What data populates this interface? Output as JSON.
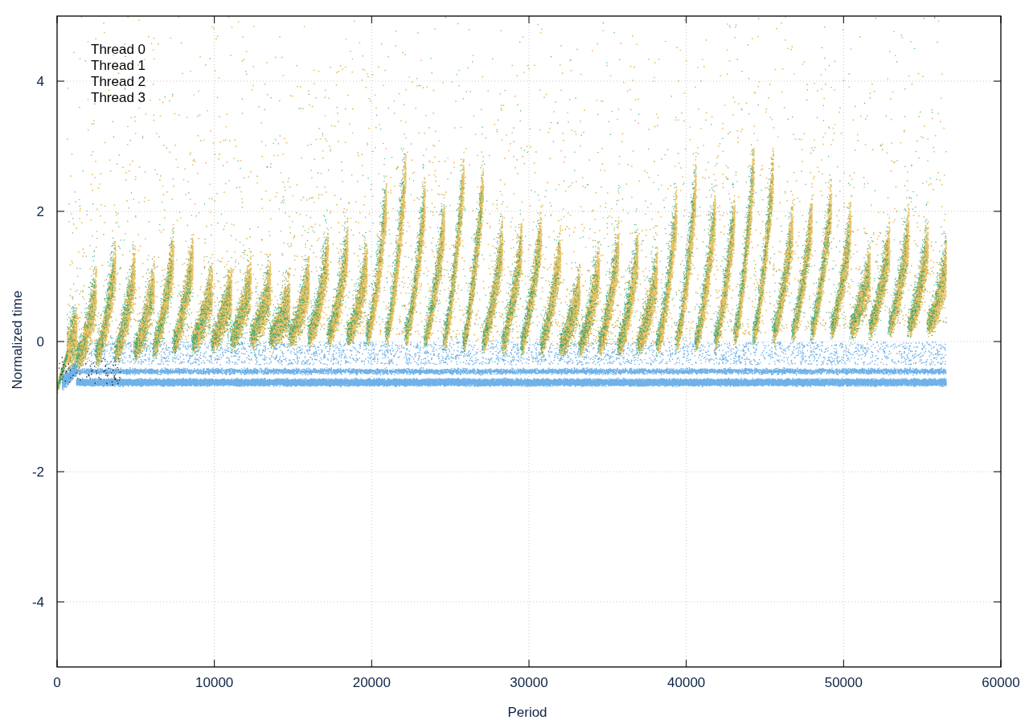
{
  "plot": {
    "x_axis_title": "Period",
    "y_axis_title": "Normalized time",
    "x_tick_labels": [
      "0",
      "10000",
      "20000",
      "30000",
      "40000",
      "50000",
      "60000"
    ],
    "y_tick_labels": [
      "4",
      "2",
      "0",
      "-2",
      "-4"
    ],
    "legend": [
      "Thread 0",
      "Thread 1",
      "Thread 2",
      "Thread 3"
    ]
  }
}
